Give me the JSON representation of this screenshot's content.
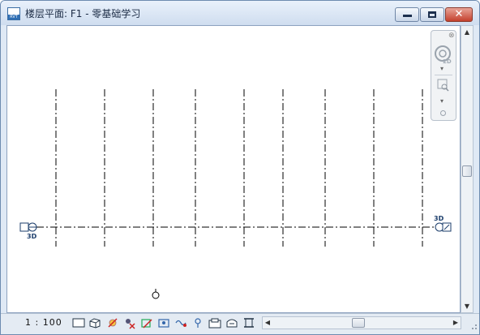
{
  "window": {
    "title": "楼层平面: F1 - 零基础学习",
    "app_icon_text": "RVT",
    "close_symbol": "✕"
  },
  "view": {
    "marker_3d_left": "3D",
    "marker_3d_right": "3D"
  },
  "navigation_bar": {
    "wheel_label": "2D",
    "close_symbol": "⊗",
    "chevron": "▾"
  },
  "status_bar": {
    "scale": "1 : 100"
  },
  "scrollbars": {
    "up": "▲",
    "down": "▼",
    "left": "◀",
    "right": "▶"
  }
}
